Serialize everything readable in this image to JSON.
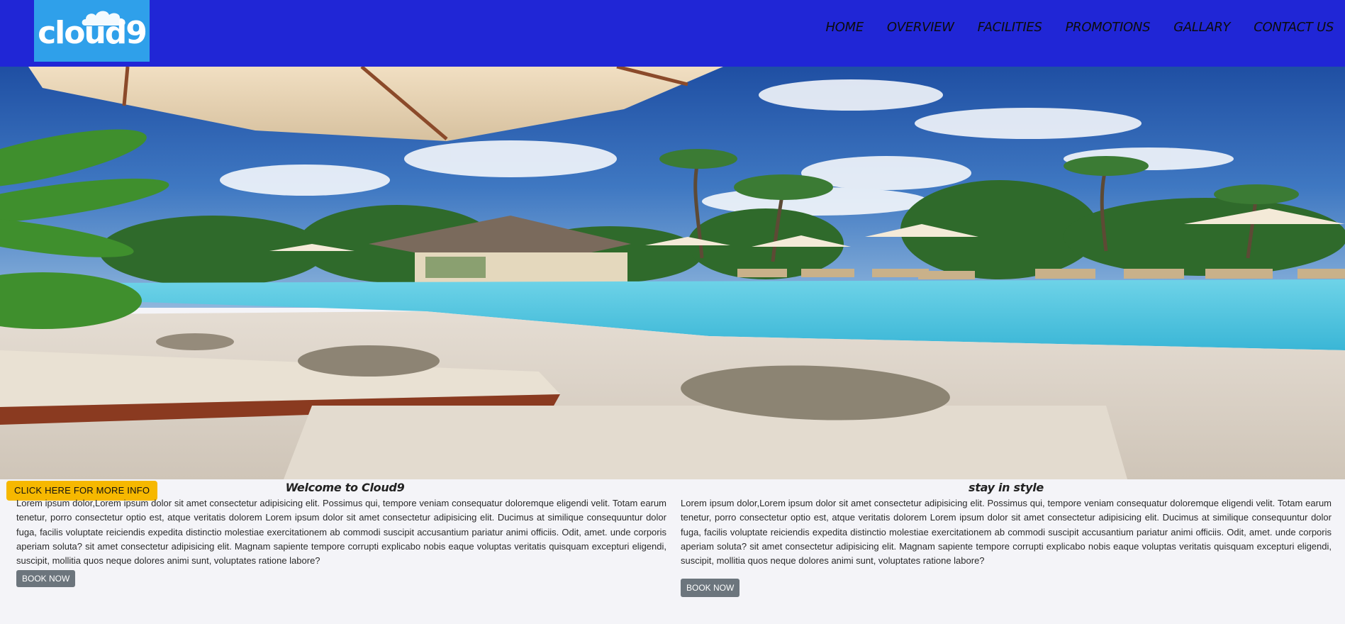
{
  "brand": {
    "logo_text": "cloud9"
  },
  "nav": {
    "items": [
      {
        "label": "HOME"
      },
      {
        "label": "OVERVIEW"
      },
      {
        "label": "FACILITIES"
      },
      {
        "label": "PROMOTIONS"
      },
      {
        "label": "GALLARY"
      },
      {
        "label": "CONTACT US"
      }
    ]
  },
  "hero": {
    "image": "resort-pool-photo"
  },
  "cta": {
    "info_label": "CLICK HERE FOR MORE INFO"
  },
  "sections": [
    {
      "title": "Welcome to Cloud9",
      "body": "Lorem ipsum dolor,Lorem ipsum dolor sit amet consectetur adipisicing elit. Possimus qui, tempore veniam consequatur doloremque eligendi velit. Totam earum tenetur, porro consectetur optio est, atque veritatis dolorem Lorem ipsum dolor sit amet consectetur adipisicing elit. Ducimus at similique consequuntur dolor fuga, facilis voluptate reiciendis expedita distinctio molestiae exercitationem ab commodi suscipit accusantium pariatur animi officiis. Odit, amet. unde corporis aperiam soluta? sit amet consectetur adipisicing elit. Magnam sapiente tempore corrupti explicabo nobis eaque voluptas veritatis quisquam excepturi eligendi, suscipit, mollitia quos neque dolores animi sunt, voluptates ratione labore?",
      "button_label": "BOOK NOW"
    },
    {
      "title": "stay in style",
      "body": "Lorem ipsum dolor,Lorem ipsum dolor sit amet consectetur adipisicing elit. Possimus qui, tempore veniam consequatur doloremque eligendi velit. Totam earum tenetur, porro consectetur optio est, atque veritatis dolorem Lorem ipsum dolor sit amet consectetur adipisicing elit. Ducimus at similique consequuntur dolor fuga, facilis voluptate reiciendis expedita distinctio molestiae exercitationem ab commodi suscipit accusantium pariatur animi officiis. Odit, amet. unde corporis aperiam soluta? sit amet consectetur adipisicing elit. Magnam sapiente tempore corrupti explicabo nobis eaque voluptas veritatis quisquam excepturi eligendi, suscipit, mollitia quos neque dolores animi sunt, voluptates ratione labore?",
      "button_label": "BOOK NOW"
    }
  ],
  "colors": {
    "navbar": "#2026d6",
    "logo_bg": "#2fa0ea",
    "cta": "#f6b800",
    "button": "#6c757d",
    "page_bg": "#f4f4f8"
  }
}
